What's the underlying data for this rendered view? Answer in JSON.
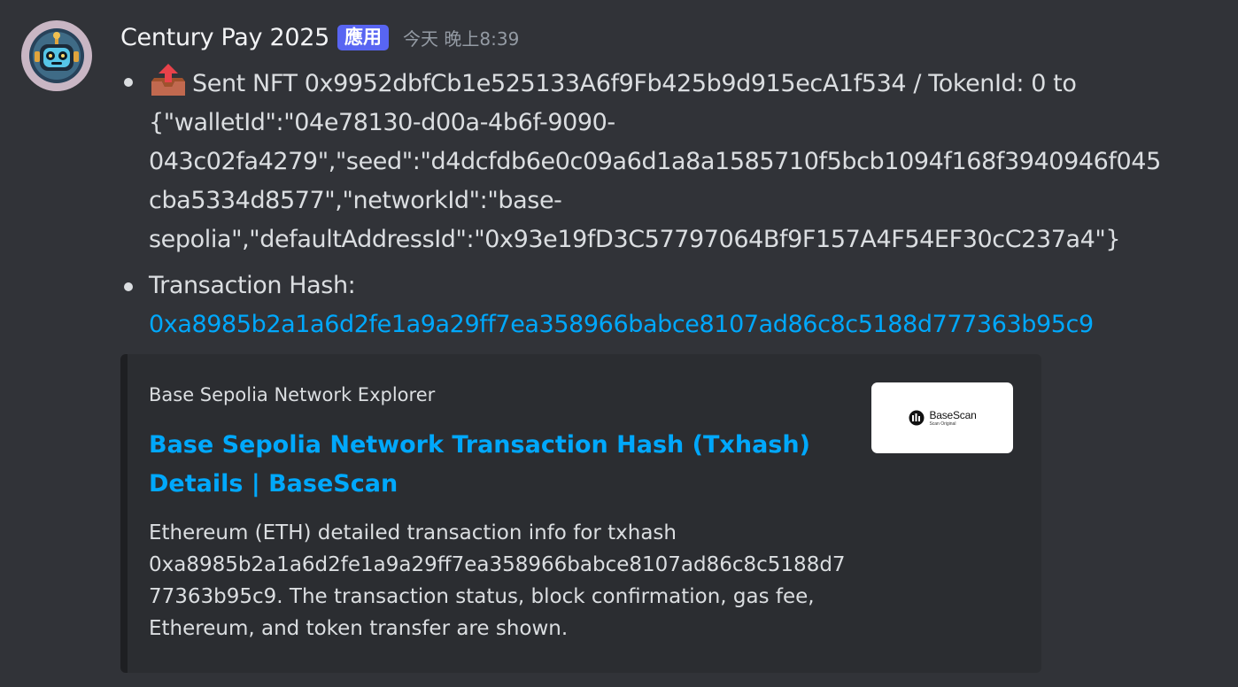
{
  "author": {
    "name": "Century Pay 2025",
    "app_tag": "應用",
    "timestamp": "今天 晚上8:39"
  },
  "message": {
    "item1": {
      "lines": [
        "Sent NFT 0x9952dbfCb1e525133A6f9Fb425b9d915ecA1f534 / TokenId: 0 to",
        "{\"walletId\":\"04e78130-d00a-4b6f-9090-",
        "043c02fa4279\",\"seed\":\"d4dcfdb6e0c09a6d1a8a1585710f5bcb1094f168f3940946f045",
        "cba5334d8577\",\"networkId\":\"base-",
        "sepolia\",\"defaultAddressId\":\"0x93e19fD3C57797064Bf9F157A4F54EF30cC237a4\"}"
      ],
      "icon": "outbox-tray-icon"
    },
    "item2": {
      "label": "Transaction Hash:",
      "hash_link": "0xa8985b2a1a6d2fe1a9a29ff7ea358966babce8107ad86c8c5188d777363b95c9"
    }
  },
  "embed": {
    "provider": "Base Sepolia Network Explorer",
    "title_lines": [
      "Base Sepolia Network Transaction Hash (Txhash)",
      "Details | BaseScan"
    ],
    "description_lines": [
      "Ethereum (ETH) detailed transaction info for txhash",
      "0xa8985b2a1a6d2fe1a9a29ff7ea358966babce8107ad86c8c5188d7",
      "77363b95c9. The transaction status, block confirmation, gas fee,",
      "Ethereum, and token transfer are shown."
    ],
    "thumbnail": {
      "brand": "BaseScan",
      "sub": "Scan Original"
    }
  },
  "colors": {
    "background": "#313338",
    "embed_background": "#2b2d31",
    "link": "#00a8fc",
    "app_tag": "#5865f2",
    "outbox_arrow": "#e8424a",
    "outbox_tray": "#c1694f"
  }
}
